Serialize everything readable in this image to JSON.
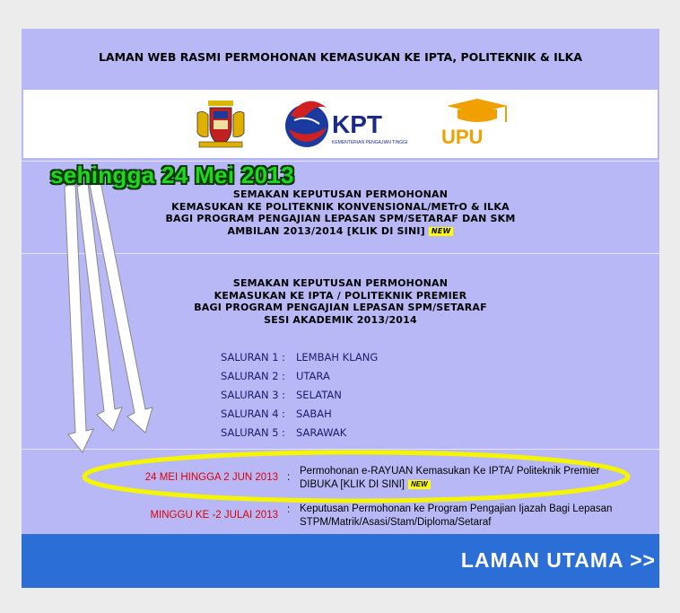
{
  "header": {
    "title": "LAMAN WEB RASMI PERMOHONAN KEMASUKAN KE IPTA, POLITEKNIK & ILKA"
  },
  "logos": {
    "kpt": "KPT",
    "kpt_sub": "KEMENTERIAN PENGAJIAN TINGGI",
    "upu": "UPU"
  },
  "badge": {
    "new": "NEW"
  },
  "block1": {
    "lines": [
      "SEMAKAN KEPUTUSAN PERMOHONAN",
      "KEMASUKAN KE POLITEKNIK KONVENSIONAL/METrO & ILKA",
      "BAGI PROGRAM PENGAJIAN LEPASAN SPM/SETARAF DAN SKM"
    ],
    "link_line": "AMBILAN 2013/2014 [KLIK DI SINI]"
  },
  "block2": {
    "lines": [
      "SEMAKAN KEPUTUSAN PERMOHONAN",
      "KEMASUKAN KE IPTA / POLITEKNIK PREMIER",
      "BAGI PROGRAM PENGAJIAN LEPASAN SPM/SETARAF",
      "SESI AKADEMIK 2013/2014"
    ]
  },
  "saluran": [
    {
      "label": "SALURAN 1",
      "colon": ":",
      "value": "LEMBAH KLANG"
    },
    {
      "label": "SALURAN 2",
      "colon": ":",
      "value": "UTARA"
    },
    {
      "label": "SALURAN 3",
      "colon": ":",
      "value": "SELATAN"
    },
    {
      "label": "SALURAN 4",
      "colon": ":",
      "value": "SABAH"
    },
    {
      "label": "SALURAN 5",
      "colon": ":",
      "value": "SARAWAK"
    }
  ],
  "events": [
    {
      "date": "24 MEI HINGGA 2 JUN 2013",
      "colon": ":",
      "line1": "Permohonan e-RAYUAN Kemasukan Ke IPTA/ Politeknik Premier",
      "line2": "DIBUKA [KLIK DI SINI]"
    },
    {
      "date": "MINGGU KE -2 JULAI 2013",
      "colon": ":",
      "line1": "Keputusan Permohonan ke Program Pengajian Ijazah Bagi Lepasan",
      "line2": "STPM/Matrik/Asasi/Stam/Diploma/Setaraf"
    }
  ],
  "footer": {
    "button": "LAMAN UTAMA >>"
  },
  "annotation": {
    "text": "sehingga 24 Mei 2013"
  },
  "colors": {
    "panel": "#b8b8f7",
    "bar": "#2b6fd6",
    "date_red": "#e00000",
    "annotation_green": "#1ed81e",
    "ellipse_yellow": "#f5f500"
  }
}
